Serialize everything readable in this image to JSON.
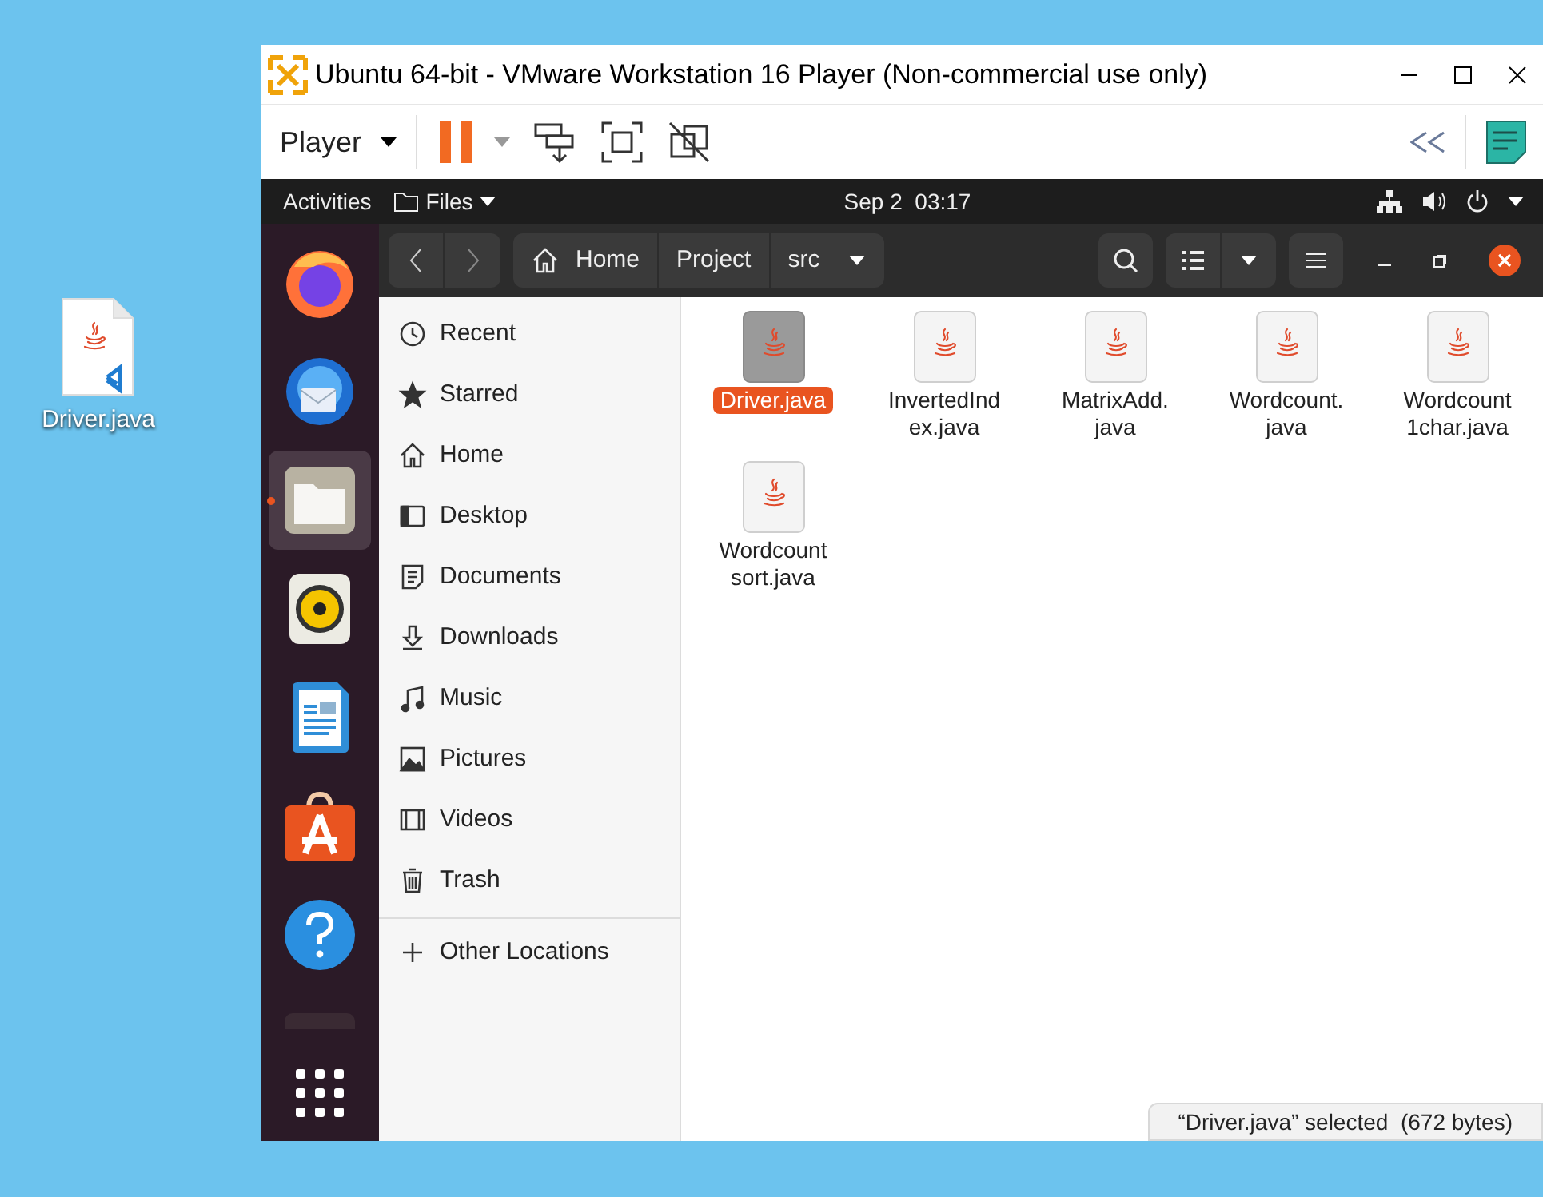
{
  "desktop_icons": [
    {
      "label": "Driver.java"
    }
  ],
  "window": {
    "title": "Ubuntu 64-bit - VMware Workstation 16 Player (Non-commercial use only)"
  },
  "toolbar": {
    "menu": "Player"
  },
  "top_bar": {
    "activities": "Activities",
    "app_menu": "Files",
    "clock": "Sep 2  03:17"
  },
  "dock": [
    {
      "kind": "firefox",
      "selected": false
    },
    {
      "kind": "thunderbird",
      "selected": false
    },
    {
      "kind": "files",
      "selected": true
    },
    {
      "kind": "rhythmbox",
      "selected": false
    },
    {
      "kind": "writer",
      "selected": false
    },
    {
      "kind": "software",
      "selected": false
    },
    {
      "kind": "help",
      "selected": false
    },
    {
      "kind": "partial",
      "selected": false
    },
    {
      "kind": "apps",
      "selected": false
    }
  ],
  "path_bar": [
    {
      "label": "Home",
      "kind": "home"
    },
    {
      "label": "Project",
      "kind": "folder"
    },
    {
      "label": "src",
      "kind": "current"
    }
  ],
  "sidebar": {
    "places": [
      {
        "label": "Recent",
        "kind": "recent"
      },
      {
        "label": "Starred",
        "kind": "starred"
      },
      {
        "label": "Home",
        "kind": "home"
      },
      {
        "label": "Desktop",
        "kind": "desktop"
      },
      {
        "label": "Documents",
        "kind": "documents"
      },
      {
        "label": "Downloads",
        "kind": "downloads"
      },
      {
        "label": "Music",
        "kind": "music"
      },
      {
        "label": "Pictures",
        "kind": "pictures"
      },
      {
        "label": "Videos",
        "kind": "videos"
      },
      {
        "label": "Trash",
        "kind": "trash"
      }
    ],
    "other": "Other Locations"
  },
  "files": [
    {
      "lines": [
        "Driver.java"
      ],
      "selected": true
    },
    {
      "lines": [
        "InvertedInd",
        "ex.java"
      ],
      "selected": false
    },
    {
      "lines": [
        "MatrixAdd.",
        "java"
      ],
      "selected": false
    },
    {
      "lines": [
        "Wordcount.",
        "java"
      ],
      "selected": false
    },
    {
      "lines": [
        "Wordcount",
        "1char.java"
      ],
      "selected": false
    },
    {
      "lines": [
        "Wordcount",
        "sort.java"
      ],
      "selected": false
    }
  ],
  "status": "“Driver.java” selected  (672 bytes)"
}
